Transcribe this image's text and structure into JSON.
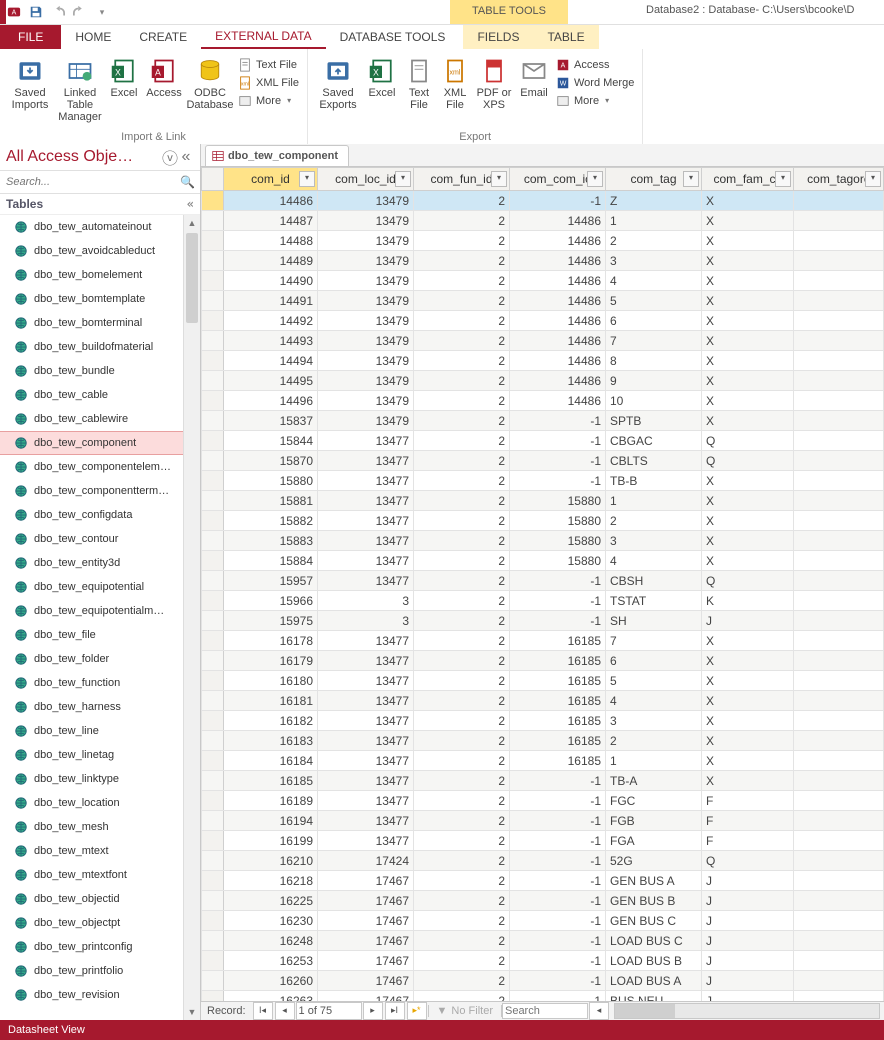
{
  "title": {
    "context_tab": "TABLE TOOLS",
    "db_label": "Database2 : Database- C:\\Users\\bcooke\\D"
  },
  "tabs": {
    "file": "FILE",
    "home": "HOME",
    "create": "CREATE",
    "external": "EXTERNAL DATA",
    "dbtools": "DATABASE TOOLS",
    "fields": "FIELDS",
    "table": "TABLE"
  },
  "ribbon": {
    "import_link": {
      "label": "Import & Link",
      "saved_imports": "Saved Imports",
      "linked_table_manager": "Linked Table Manager",
      "excel": "Excel",
      "access": "Access",
      "odbc": "ODBC Database",
      "text_file": "Text File",
      "xml_file": "XML File",
      "more": "More"
    },
    "export": {
      "label": "Export",
      "saved_exports": "Saved Exports",
      "excel": "Excel",
      "text_file": "Text File",
      "xml_file": "XML File",
      "pdf_xps": "PDF or XPS",
      "email": "Email",
      "access": "Access",
      "word_merge": "Word Merge",
      "more": "More"
    }
  },
  "nav": {
    "title": "All Access Obje…",
    "search_placeholder": "Search...",
    "category": "Tables",
    "selected": "dbo_tew_component",
    "items": [
      "dbo_tew_automateinout",
      "dbo_tew_avoidcableduct",
      "dbo_tew_bomelement",
      "dbo_tew_bomtemplate",
      "dbo_tew_bomterminal",
      "dbo_tew_buildofmaterial",
      "dbo_tew_bundle",
      "dbo_tew_cable",
      "dbo_tew_cablewire",
      "dbo_tew_component",
      "dbo_tew_componentelem…",
      "dbo_tew_componentterm…",
      "dbo_tew_configdata",
      "dbo_tew_contour",
      "dbo_tew_entity3d",
      "dbo_tew_equipotential",
      "dbo_tew_equipotentialm…",
      "dbo_tew_file",
      "dbo_tew_folder",
      "dbo_tew_function",
      "dbo_tew_harness",
      "dbo_tew_line",
      "dbo_tew_linetag",
      "dbo_tew_linktype",
      "dbo_tew_location",
      "dbo_tew_mesh",
      "dbo_tew_mtext",
      "dbo_tew_mtextfont",
      "dbo_tew_objectid",
      "dbo_tew_objectpt",
      "dbo_tew_printconfig",
      "dbo_tew_printfolio",
      "dbo_tew_revision"
    ]
  },
  "sheet": {
    "tab_name": "dbo_tew_component",
    "columns": [
      "com_id",
      "com_loc_id",
      "com_fun_id",
      "com_com_ic",
      "com_tag",
      "com_fam_cc",
      "com_tagorc"
    ],
    "rows": [
      {
        "com_id": 14486,
        "com_loc_id": 13479,
        "com_fun_id": 2,
        "com_com_ic": -1,
        "com_tag": "Z",
        "com_fam_cc": "X"
      },
      {
        "com_id": 14487,
        "com_loc_id": 13479,
        "com_fun_id": 2,
        "com_com_ic": 14486,
        "com_tag": "1",
        "com_fam_cc": "X"
      },
      {
        "com_id": 14488,
        "com_loc_id": 13479,
        "com_fun_id": 2,
        "com_com_ic": 14486,
        "com_tag": "2",
        "com_fam_cc": "X"
      },
      {
        "com_id": 14489,
        "com_loc_id": 13479,
        "com_fun_id": 2,
        "com_com_ic": 14486,
        "com_tag": "3",
        "com_fam_cc": "X"
      },
      {
        "com_id": 14490,
        "com_loc_id": 13479,
        "com_fun_id": 2,
        "com_com_ic": 14486,
        "com_tag": "4",
        "com_fam_cc": "X"
      },
      {
        "com_id": 14491,
        "com_loc_id": 13479,
        "com_fun_id": 2,
        "com_com_ic": 14486,
        "com_tag": "5",
        "com_fam_cc": "X"
      },
      {
        "com_id": 14492,
        "com_loc_id": 13479,
        "com_fun_id": 2,
        "com_com_ic": 14486,
        "com_tag": "6",
        "com_fam_cc": "X"
      },
      {
        "com_id": 14493,
        "com_loc_id": 13479,
        "com_fun_id": 2,
        "com_com_ic": 14486,
        "com_tag": "7",
        "com_fam_cc": "X"
      },
      {
        "com_id": 14494,
        "com_loc_id": 13479,
        "com_fun_id": 2,
        "com_com_ic": 14486,
        "com_tag": "8",
        "com_fam_cc": "X"
      },
      {
        "com_id": 14495,
        "com_loc_id": 13479,
        "com_fun_id": 2,
        "com_com_ic": 14486,
        "com_tag": "9",
        "com_fam_cc": "X"
      },
      {
        "com_id": 14496,
        "com_loc_id": 13479,
        "com_fun_id": 2,
        "com_com_ic": 14486,
        "com_tag": "10",
        "com_fam_cc": "X"
      },
      {
        "com_id": 15837,
        "com_loc_id": 13479,
        "com_fun_id": 2,
        "com_com_ic": -1,
        "com_tag": "SPTB",
        "com_fam_cc": "X"
      },
      {
        "com_id": 15844,
        "com_loc_id": 13477,
        "com_fun_id": 2,
        "com_com_ic": -1,
        "com_tag": "CBGAC",
        "com_fam_cc": "Q"
      },
      {
        "com_id": 15870,
        "com_loc_id": 13477,
        "com_fun_id": 2,
        "com_com_ic": -1,
        "com_tag": "CBLTS",
        "com_fam_cc": "Q"
      },
      {
        "com_id": 15880,
        "com_loc_id": 13477,
        "com_fun_id": 2,
        "com_com_ic": -1,
        "com_tag": "TB-B",
        "com_fam_cc": "X"
      },
      {
        "com_id": 15881,
        "com_loc_id": 13477,
        "com_fun_id": 2,
        "com_com_ic": 15880,
        "com_tag": "1",
        "com_fam_cc": "X"
      },
      {
        "com_id": 15882,
        "com_loc_id": 13477,
        "com_fun_id": 2,
        "com_com_ic": 15880,
        "com_tag": "2",
        "com_fam_cc": "X"
      },
      {
        "com_id": 15883,
        "com_loc_id": 13477,
        "com_fun_id": 2,
        "com_com_ic": 15880,
        "com_tag": "3",
        "com_fam_cc": "X"
      },
      {
        "com_id": 15884,
        "com_loc_id": 13477,
        "com_fun_id": 2,
        "com_com_ic": 15880,
        "com_tag": "4",
        "com_fam_cc": "X"
      },
      {
        "com_id": 15957,
        "com_loc_id": 13477,
        "com_fun_id": 2,
        "com_com_ic": -1,
        "com_tag": "CBSH",
        "com_fam_cc": "Q"
      },
      {
        "com_id": 15966,
        "com_loc_id": 3,
        "com_fun_id": 2,
        "com_com_ic": -1,
        "com_tag": "TSTAT",
        "com_fam_cc": "K"
      },
      {
        "com_id": 15975,
        "com_loc_id": 3,
        "com_fun_id": 2,
        "com_com_ic": -1,
        "com_tag": "SH",
        "com_fam_cc": "J"
      },
      {
        "com_id": 16178,
        "com_loc_id": 13477,
        "com_fun_id": 2,
        "com_com_ic": 16185,
        "com_tag": "7",
        "com_fam_cc": "X"
      },
      {
        "com_id": 16179,
        "com_loc_id": 13477,
        "com_fun_id": 2,
        "com_com_ic": 16185,
        "com_tag": "6",
        "com_fam_cc": "X"
      },
      {
        "com_id": 16180,
        "com_loc_id": 13477,
        "com_fun_id": 2,
        "com_com_ic": 16185,
        "com_tag": "5",
        "com_fam_cc": "X"
      },
      {
        "com_id": 16181,
        "com_loc_id": 13477,
        "com_fun_id": 2,
        "com_com_ic": 16185,
        "com_tag": "4",
        "com_fam_cc": "X"
      },
      {
        "com_id": 16182,
        "com_loc_id": 13477,
        "com_fun_id": 2,
        "com_com_ic": 16185,
        "com_tag": "3",
        "com_fam_cc": "X"
      },
      {
        "com_id": 16183,
        "com_loc_id": 13477,
        "com_fun_id": 2,
        "com_com_ic": 16185,
        "com_tag": "2",
        "com_fam_cc": "X"
      },
      {
        "com_id": 16184,
        "com_loc_id": 13477,
        "com_fun_id": 2,
        "com_com_ic": 16185,
        "com_tag": "1",
        "com_fam_cc": "X"
      },
      {
        "com_id": 16185,
        "com_loc_id": 13477,
        "com_fun_id": 2,
        "com_com_ic": -1,
        "com_tag": "TB-A",
        "com_fam_cc": "X"
      },
      {
        "com_id": 16189,
        "com_loc_id": 13477,
        "com_fun_id": 2,
        "com_com_ic": -1,
        "com_tag": "FGC",
        "com_fam_cc": "F"
      },
      {
        "com_id": 16194,
        "com_loc_id": 13477,
        "com_fun_id": 2,
        "com_com_ic": -1,
        "com_tag": "FGB",
        "com_fam_cc": "F"
      },
      {
        "com_id": 16199,
        "com_loc_id": 13477,
        "com_fun_id": 2,
        "com_com_ic": -1,
        "com_tag": "FGA",
        "com_fam_cc": "F"
      },
      {
        "com_id": 16210,
        "com_loc_id": 17424,
        "com_fun_id": 2,
        "com_com_ic": -1,
        "com_tag": "52G",
        "com_fam_cc": "Q"
      },
      {
        "com_id": 16218,
        "com_loc_id": 17467,
        "com_fun_id": 2,
        "com_com_ic": -1,
        "com_tag": "GEN BUS A",
        "com_fam_cc": "J"
      },
      {
        "com_id": 16225,
        "com_loc_id": 17467,
        "com_fun_id": 2,
        "com_com_ic": -1,
        "com_tag": "GEN BUS B",
        "com_fam_cc": "J"
      },
      {
        "com_id": 16230,
        "com_loc_id": 17467,
        "com_fun_id": 2,
        "com_com_ic": -1,
        "com_tag": "GEN BUS C",
        "com_fam_cc": "J"
      },
      {
        "com_id": 16248,
        "com_loc_id": 17467,
        "com_fun_id": 2,
        "com_com_ic": -1,
        "com_tag": "LOAD BUS C",
        "com_fam_cc": "J"
      },
      {
        "com_id": 16253,
        "com_loc_id": 17467,
        "com_fun_id": 2,
        "com_com_ic": -1,
        "com_tag": "LOAD BUS B",
        "com_fam_cc": "J"
      },
      {
        "com_id": 16260,
        "com_loc_id": 17467,
        "com_fun_id": 2,
        "com_com_ic": -1,
        "com_tag": "LOAD BUS A",
        "com_fam_cc": "J"
      },
      {
        "com_id": 16263,
        "com_loc_id": 17467,
        "com_fun_id": 2,
        "com_com_ic": -1,
        "com_tag": "BUS NEU",
        "com_fam_cc": "J"
      }
    ],
    "record_nav": {
      "label": "Record:",
      "position": "1 of 75",
      "no_filter": "No Filter",
      "search_placeholder": "Search"
    }
  },
  "status": {
    "view": "Datasheet View"
  }
}
